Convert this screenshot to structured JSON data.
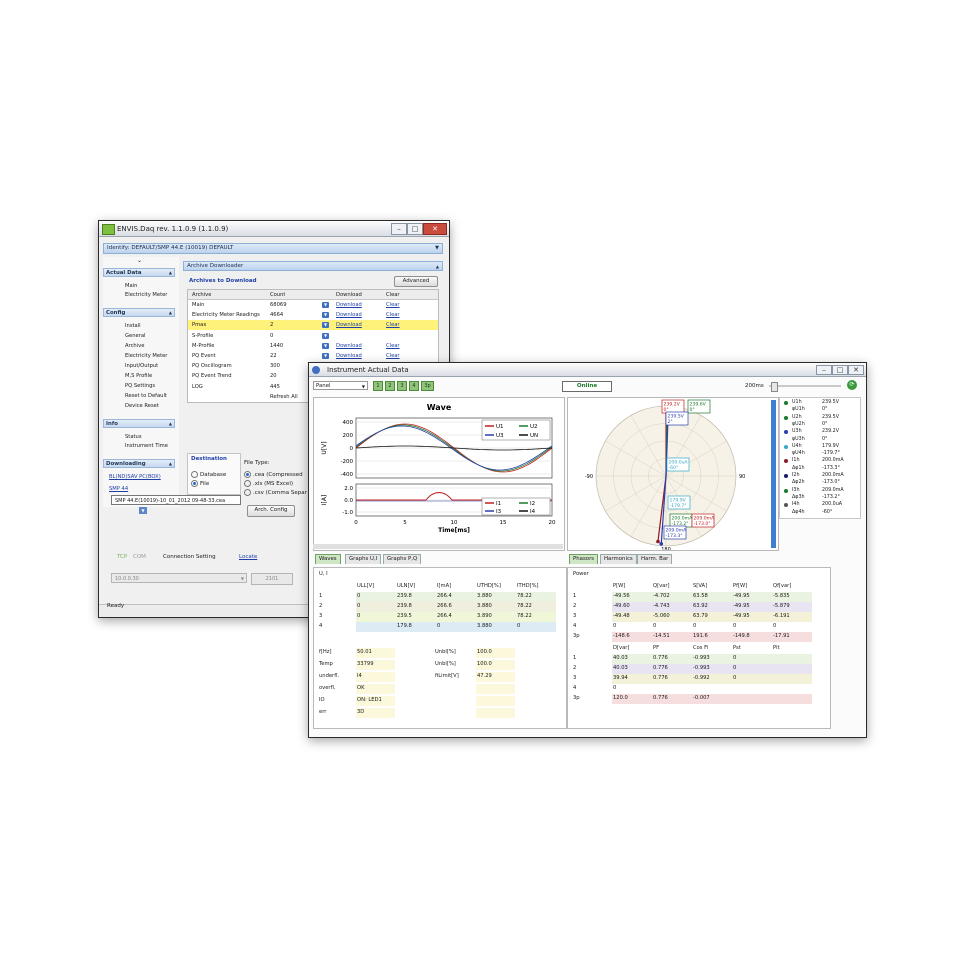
{
  "colors": {
    "accent": "#3f6fc0",
    "highlight": "#fff27a",
    "online": "#1b7a2a"
  },
  "back_window": {
    "title": "ENVIS.Daq rev. 1.1.0.9 (1.1.0.9)",
    "identify": "Identify: DEFAULT/SMP 44.E (10019) DEFAULT",
    "nav": {
      "actual_data": {
        "header": "Actual Data",
        "items": [
          "Main",
          "Electricity Meter"
        ]
      },
      "config": {
        "header": "Config",
        "items": [
          "Install",
          "General",
          "Archive",
          "Electricity Meter",
          "Input/Output",
          "M,S Profile",
          "PQ Settings",
          "Reset to Default",
          "Device Reset"
        ]
      },
      "info": {
        "header": "Info",
        "items": [
          "Status",
          "Instrument Time"
        ]
      },
      "downloading": {
        "header": "Downloading",
        "links": [
          "BL(ND)SAV PC(BOX)",
          "SMP 44"
        ]
      }
    },
    "tooltip": "SMP 44.E(10019)-10_01_2012 09-48-33.cea",
    "panel_title": "Archive Downloader",
    "archives_label": "Archives to Download",
    "advanced_button": "Advanced",
    "columns": [
      "Archive",
      "Count",
      "",
      "Download",
      "Clear"
    ],
    "rows": [
      {
        "archive": "Main",
        "count": "68069",
        "download": "Download",
        "clear": "Clear",
        "dl": true,
        "hl": false
      },
      {
        "archive": "Electricity Meter Readings",
        "count": "4664",
        "download": "Download",
        "clear": "Clear",
        "dl": true,
        "hl": false
      },
      {
        "archive": "Pmax",
        "count": "2",
        "download": "Download",
        "clear": "Clear",
        "dl": true,
        "hl": true
      },
      {
        "archive": "S-Profile",
        "count": "0",
        "download": "",
        "clear": "",
        "dl": true,
        "hl": false
      },
      {
        "archive": "M-Profile",
        "count": "1440",
        "download": "Download",
        "clear": "Clear",
        "dl": true,
        "hl": false
      },
      {
        "archive": "PQ Event",
        "count": "22",
        "download": "Download",
        "clear": "Clear",
        "dl": true,
        "hl": false
      },
      {
        "archive": "PQ Oscillogram",
        "count": "300",
        "download": "",
        "clear": "",
        "dl": false,
        "hl": false
      },
      {
        "archive": "PQ Event Trend",
        "count": "20",
        "download": "",
        "clear": "",
        "dl": false,
        "hl": false
      },
      {
        "archive": "LOG",
        "count": "445",
        "download": "",
        "clear": "",
        "dl": false,
        "hl": false
      },
      {
        "archive": "",
        "count": "Refresh All",
        "download": "",
        "clear": "",
        "dl": false,
        "hl": false
      }
    ],
    "destination": {
      "label": "Destination",
      "options": [
        "Database",
        "File"
      ]
    },
    "file_type": {
      "label": "File Type:",
      "options": [
        ".cea (Compressed",
        ".xls (MS Excel)",
        ".csv (Comma Separ"
      ]
    },
    "arch_config_button": "Arch. Config",
    "conn_tabs": [
      "TCP",
      "COM"
    ],
    "connection_setting": "Connection Setting",
    "locate_link": "Locate",
    "address": "10.0.0.30",
    "port": "2101",
    "status": "Ready"
  },
  "front_window": {
    "title": "Instrument Actual Data",
    "panel_select": "Panel",
    "num_buttons": [
      "1",
      "2",
      "3",
      "4",
      "3p"
    ],
    "online_label": "Online",
    "interval": "200ms",
    "wave_chart": {
      "title": "Wave",
      "ylabel_u": "U[V]",
      "ylabel_i": "I[A]",
      "xlabel": "Time[ms]",
      "u_ticks": [
        "400",
        "200",
        "0",
        "-200",
        "-400"
      ],
      "i_ticks": [
        "2.0",
        "0.0",
        "-1.0"
      ],
      "x_ticks": [
        "0",
        "5",
        "10",
        "15",
        "20"
      ],
      "legend_u": [
        "U1",
        "U2",
        "U3",
        "UN"
      ],
      "legend_i": [
        "I1",
        "I2",
        "I3",
        "I4"
      ]
    },
    "wave_tabs": [
      "Waves",
      "Graphs U,I",
      "Graphs P,Q"
    ],
    "phasor": {
      "labels": {
        "top": "0",
        "right": "90",
        "left": "-90",
        "bottom": "180"
      },
      "tags": [
        "239.2V\n0°",
        "239.6V\n0°",
        "239.5V\n2°",
        "200.0uA\n-60°",
        "179.9V\n-179.7°",
        "200.0mA\n-173.2°",
        "209.0mA\n-173.0°",
        "209.0mA\n-173.3°"
      ],
      "legend": [
        {
          "name": "U1h",
          "val": "239.5V"
        },
        {
          "name": "φU1h",
          "val": "0°"
        },
        {
          "name": "U2h",
          "val": "239.5V"
        },
        {
          "name": "φU2h",
          "val": "0°"
        },
        {
          "name": "U3h",
          "val": "239.2V"
        },
        {
          "name": "φU3h",
          "val": "0°"
        },
        {
          "name": "U4h",
          "val": "179.9V"
        },
        {
          "name": "φU4h",
          "val": "-179.7°"
        },
        {
          "name": "I1h",
          "val": "200.0mA"
        },
        {
          "name": "Δφ1h",
          "val": "-173.3°"
        },
        {
          "name": "I2h",
          "val": "200.0mA"
        },
        {
          "name": "Δφ2h",
          "val": "-173.0°"
        },
        {
          "name": "I3h",
          "val": "209.0mA"
        },
        {
          "name": "Δφ3h",
          "val": "-173.2°"
        },
        {
          "name": "I4h",
          "val": "200.0uA"
        },
        {
          "name": "Δφ4h",
          "val": "-60°"
        }
      ]
    },
    "phasor_tabs": [
      "Phasors",
      "Harmonics",
      "Harm. Bar"
    ],
    "ui_table": {
      "label": "U, I",
      "columns": [
        "",
        "ULL[V]",
        "ULN[V]",
        "I[mA]",
        "UTHD[%]",
        "ITHD[%]"
      ],
      "rows": [
        [
          "1",
          "0",
          "239.8",
          "266.4",
          "3.880",
          "78.22"
        ],
        [
          "2",
          "0",
          "239.8",
          "266.6",
          "3.880",
          "78.22"
        ],
        [
          "3",
          "0",
          "239.5",
          "266.4",
          "3.890",
          "78.22"
        ],
        [
          "4",
          "",
          "179.8",
          "0",
          "3.880",
          "0"
        ]
      ],
      "extra": [
        [
          "f[Hz]",
          "50.01",
          "Unbl[%]",
          "100.0"
        ],
        [
          "Temp",
          "33799",
          "Unbl[%]",
          "100.0"
        ],
        [
          "underfl.",
          "I4",
          "fiLimit[V]",
          "47.29"
        ],
        [
          "overfl.",
          "OK",
          "",
          ""
        ],
        [
          "IO",
          "ON: LED1",
          "",
          ""
        ],
        [
          "err",
          "3D",
          "",
          ""
        ]
      ]
    },
    "power_table": {
      "label": "Power",
      "columns": [
        "",
        "P[W]",
        "Q[var]",
        "S[VA]",
        "Pf[W]",
        "Qf[var]"
      ],
      "rows": [
        [
          "1",
          "-49.56",
          "-4.702",
          "63.58",
          "-49.95",
          "-5.835"
        ],
        [
          "2",
          "-49.60",
          "-4.743",
          "63.92",
          "-49.95",
          "-5.879"
        ],
        [
          "3",
          "-49.48",
          "-5.060",
          "63.79",
          "-49.95",
          "-6.191"
        ],
        [
          "4",
          "0",
          "0",
          "0",
          "0",
          "0"
        ],
        [
          "3p",
          "-148.6",
          "-14.51",
          "191.6",
          "-149.8",
          "-17.91"
        ]
      ],
      "columns2": [
        "",
        "D[var]",
        "PF",
        "Cos Fi",
        "Pst",
        "Plt"
      ],
      "rows2": [
        [
          "1",
          "40.03",
          "0.776",
          "-0.993",
          "0",
          ""
        ],
        [
          "2",
          "40.03",
          "0.776",
          "-0.993",
          "0",
          ""
        ],
        [
          "3",
          "39.94",
          "0.776",
          "-0.992",
          "0",
          ""
        ],
        [
          "4",
          "0",
          "",
          "",
          "",
          ""
        ],
        [
          "3p",
          "120.0",
          "0.776",
          "-0.007",
          "",
          ""
        ]
      ]
    }
  }
}
